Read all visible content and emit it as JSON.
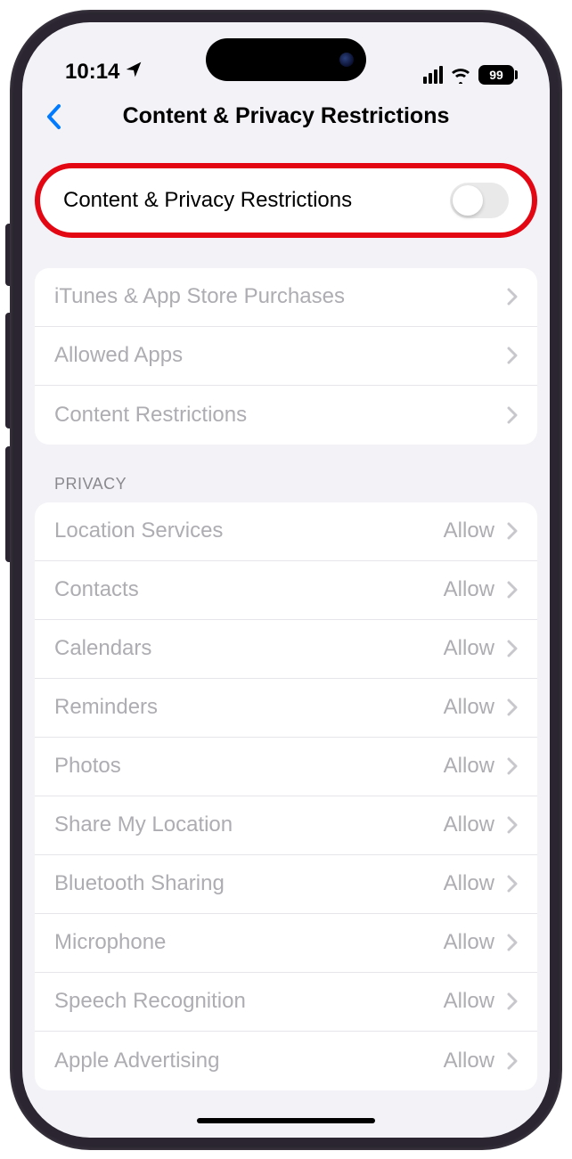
{
  "status": {
    "time": "10:14",
    "battery": "99"
  },
  "nav": {
    "title": "Content & Privacy Restrictions"
  },
  "toggle": {
    "label": "Content & Privacy Restrictions"
  },
  "section1": {
    "items": [
      {
        "label": "iTunes & App Store Purchases"
      },
      {
        "label": "Allowed Apps"
      },
      {
        "label": "Content Restrictions"
      }
    ]
  },
  "section2": {
    "header": "PRIVACY",
    "items": [
      {
        "label": "Location Services",
        "value": "Allow"
      },
      {
        "label": "Contacts",
        "value": "Allow"
      },
      {
        "label": "Calendars",
        "value": "Allow"
      },
      {
        "label": "Reminders",
        "value": "Allow"
      },
      {
        "label": "Photos",
        "value": "Allow"
      },
      {
        "label": "Share My Location",
        "value": "Allow"
      },
      {
        "label": "Bluetooth Sharing",
        "value": "Allow"
      },
      {
        "label": "Microphone",
        "value": "Allow"
      },
      {
        "label": "Speech Recognition",
        "value": "Allow"
      },
      {
        "label": "Apple Advertising",
        "value": "Allow"
      }
    ]
  }
}
